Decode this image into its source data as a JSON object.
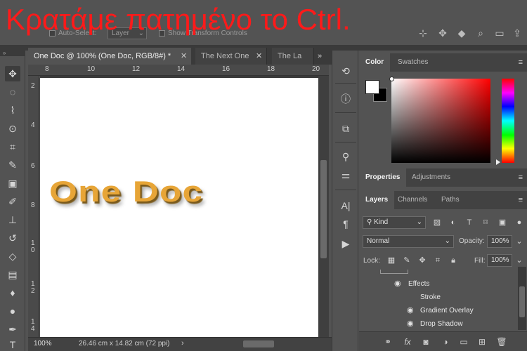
{
  "overlay_caption": "Κρατάμε πατημένο το Ctrl.",
  "options_bar": {
    "auto_select_label": "Auto-Select:",
    "auto_select_mode": "Layer",
    "show_transform_label": "Show Transform Controls",
    "icons": [
      "move-icon",
      "search-icon",
      "workspace-icon",
      "share-icon"
    ]
  },
  "document": {
    "tabs": [
      {
        "label": "One Doc @ 100% (One Doc, RGB/8#) *",
        "active": true
      },
      {
        "label": "The Next One",
        "active": false
      },
      {
        "label": "The La",
        "active": false
      }
    ],
    "tab_overflow": "»",
    "ruler_top_labels": [
      "8",
      "10",
      "12",
      "14",
      "16",
      "18",
      "20"
    ],
    "ruler_left_labels": [
      "2",
      "4",
      "6",
      "8",
      "1 0",
      "1 2",
      "1 4"
    ],
    "canvas_text": "One Doc",
    "text_colors": {
      "fill": "#e7a537",
      "shadow": "#7a5a1c"
    },
    "zoom": "100%",
    "doc_size": "26.46 cm x 14.82 cm (72 ppi)",
    "status_arrow": "›"
  },
  "color_panel": {
    "tabs": [
      "Color",
      "Swatches"
    ],
    "foreground": "#ffffff",
    "background": "#000000",
    "menu": "≡"
  },
  "properties_panel": {
    "tabs": [
      "Properties",
      "Adjustments"
    ],
    "menu": "≡"
  },
  "layers_panel": {
    "tabs": [
      "Layers",
      "Channels",
      "Paths"
    ],
    "menu": "≡",
    "filter_kind": "Kind",
    "blend_mode": "Normal",
    "opacity_label": "Opacity:",
    "opacity_value": "100%",
    "lock_label": "Lock:",
    "fill_label": "Fill:",
    "fill_value": "100%",
    "effects_label": "Effects",
    "effects": [
      {
        "label": "Stroke",
        "visible": false
      },
      {
        "label": "Gradient Overlay",
        "visible": true
      },
      {
        "label": "Drop Shadow",
        "visible": true
      }
    ],
    "footer_icons": [
      "link-icon",
      "fx-icon",
      "mask-icon",
      "adjustment-icon",
      "group-icon",
      "new-layer-icon",
      "trash-icon"
    ],
    "fx_label": "fx"
  }
}
